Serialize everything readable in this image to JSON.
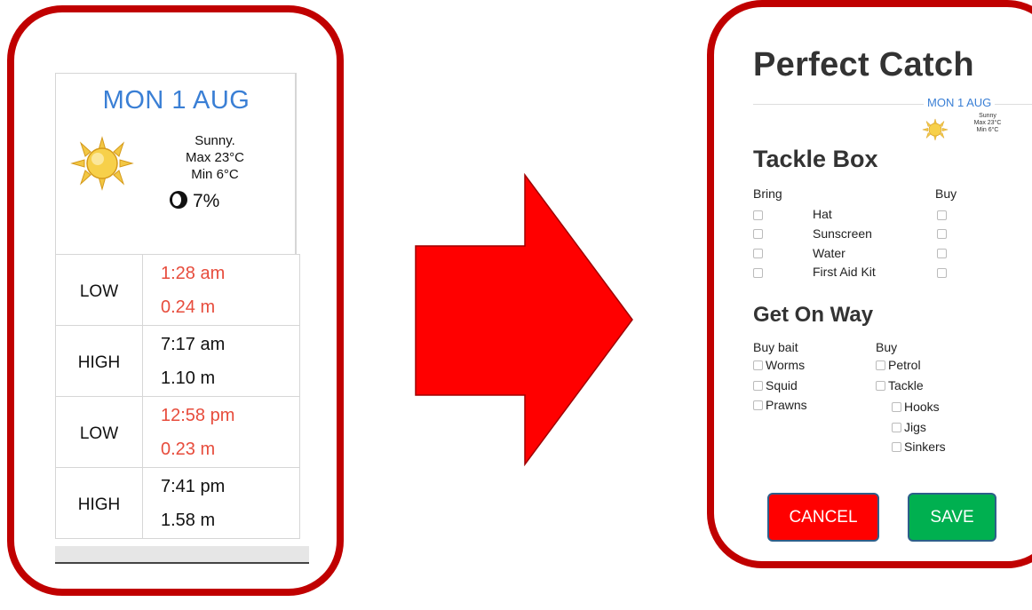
{
  "left_screen": {
    "forecast": {
      "date": "MON 1 AUG",
      "icon": "sun-icon",
      "lines": [
        "Sunny.",
        "Max 23°C",
        "Min 6°C"
      ],
      "moon_icon": "moon-icon",
      "moon_illumination": "7%"
    },
    "tides": [
      {
        "type": "LOW",
        "time": "1:28 am",
        "height": "0.24 m"
      },
      {
        "type": "HIGH",
        "time": "7:17 am",
        "height": "1.10 m"
      },
      {
        "type": "LOW",
        "time": "12:58 pm",
        "height": "0.23 m"
      },
      {
        "type": "HIGH",
        "time": "7:41 pm",
        "height": "1.58 m"
      }
    ]
  },
  "colors": {
    "frame": "#c00000",
    "arrow": "#ff0000",
    "date_blue": "#3a7fd5",
    "low_tide_red": "#e74c3c",
    "cancel": "#ff0000",
    "save": "#00b050"
  },
  "right_screen": {
    "title": "Perfect Catch",
    "forecast": {
      "date": "MON 1 AUG",
      "lines": [
        "Sunny",
        "Max 23°C",
        "Min 6°C"
      ]
    },
    "tackle_box": {
      "title": "Tackle Box",
      "bring_label": "Bring",
      "buy_label": "Buy",
      "items": [
        "Hat",
        "Sunscreen",
        "Water",
        "First Aid Kit"
      ]
    },
    "get_on_way": {
      "title": "Get On Way",
      "bait_label": "Buy bait",
      "buy_label": "Buy",
      "bait_items": [
        "Worms",
        "Squid",
        "Prawns"
      ],
      "buy_items": [
        "Petrol",
        "Tackle"
      ],
      "tackle_sub_items": [
        "Hooks",
        "Jigs",
        "Sinkers"
      ]
    },
    "buttons": {
      "cancel": "CANCEL",
      "save": "SAVE"
    }
  }
}
